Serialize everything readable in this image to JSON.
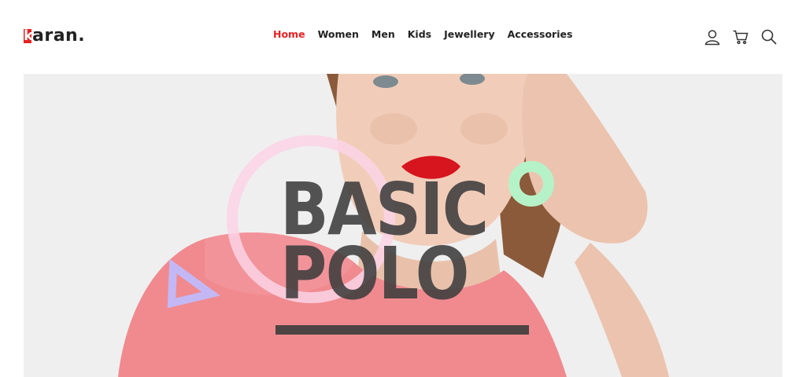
{
  "brand": {
    "logo_initial": "k",
    "logo_text": "aran.",
    "accent_color": "#e62222"
  },
  "nav": {
    "items": [
      {
        "label": "Home",
        "active": true
      },
      {
        "label": "Women",
        "active": false
      },
      {
        "label": "Men",
        "active": false
      },
      {
        "label": "Kids",
        "active": false
      },
      {
        "label": "Jewellery",
        "active": false
      },
      {
        "label": "Accessories",
        "active": false
      }
    ]
  },
  "header_icons": [
    "user-icon",
    "cart-icon",
    "search-icon"
  ],
  "hero": {
    "title_line1": "BASIC",
    "title_line2": "POLO",
    "background_color": "#efefef",
    "shirt_color": "#f08a8f"
  }
}
